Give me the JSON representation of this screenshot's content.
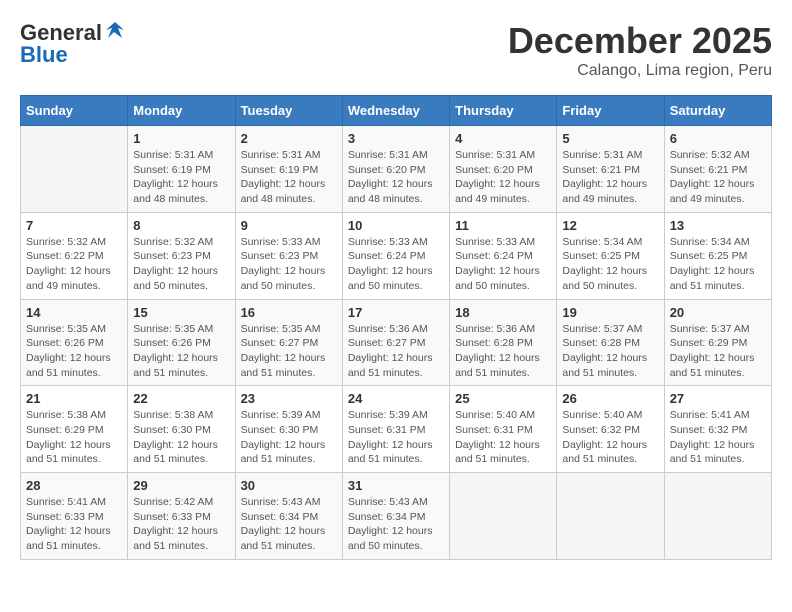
{
  "header": {
    "logo_general": "General",
    "logo_blue": "Blue",
    "title": "December 2025",
    "location": "Calango, Lima region, Peru"
  },
  "weekdays": [
    "Sunday",
    "Monday",
    "Tuesday",
    "Wednesday",
    "Thursday",
    "Friday",
    "Saturday"
  ],
  "weeks": [
    [
      {
        "day": "",
        "info": ""
      },
      {
        "day": "1",
        "info": "Sunrise: 5:31 AM\nSunset: 6:19 PM\nDaylight: 12 hours\nand 48 minutes."
      },
      {
        "day": "2",
        "info": "Sunrise: 5:31 AM\nSunset: 6:19 PM\nDaylight: 12 hours\nand 48 minutes."
      },
      {
        "day": "3",
        "info": "Sunrise: 5:31 AM\nSunset: 6:20 PM\nDaylight: 12 hours\nand 48 minutes."
      },
      {
        "day": "4",
        "info": "Sunrise: 5:31 AM\nSunset: 6:20 PM\nDaylight: 12 hours\nand 49 minutes."
      },
      {
        "day": "5",
        "info": "Sunrise: 5:31 AM\nSunset: 6:21 PM\nDaylight: 12 hours\nand 49 minutes."
      },
      {
        "day": "6",
        "info": "Sunrise: 5:32 AM\nSunset: 6:21 PM\nDaylight: 12 hours\nand 49 minutes."
      }
    ],
    [
      {
        "day": "7",
        "info": "Sunrise: 5:32 AM\nSunset: 6:22 PM\nDaylight: 12 hours\nand 49 minutes."
      },
      {
        "day": "8",
        "info": "Sunrise: 5:32 AM\nSunset: 6:23 PM\nDaylight: 12 hours\nand 50 minutes."
      },
      {
        "day": "9",
        "info": "Sunrise: 5:33 AM\nSunset: 6:23 PM\nDaylight: 12 hours\nand 50 minutes."
      },
      {
        "day": "10",
        "info": "Sunrise: 5:33 AM\nSunset: 6:24 PM\nDaylight: 12 hours\nand 50 minutes."
      },
      {
        "day": "11",
        "info": "Sunrise: 5:33 AM\nSunset: 6:24 PM\nDaylight: 12 hours\nand 50 minutes."
      },
      {
        "day": "12",
        "info": "Sunrise: 5:34 AM\nSunset: 6:25 PM\nDaylight: 12 hours\nand 50 minutes."
      },
      {
        "day": "13",
        "info": "Sunrise: 5:34 AM\nSunset: 6:25 PM\nDaylight: 12 hours\nand 51 minutes."
      }
    ],
    [
      {
        "day": "14",
        "info": "Sunrise: 5:35 AM\nSunset: 6:26 PM\nDaylight: 12 hours\nand 51 minutes."
      },
      {
        "day": "15",
        "info": "Sunrise: 5:35 AM\nSunset: 6:26 PM\nDaylight: 12 hours\nand 51 minutes."
      },
      {
        "day": "16",
        "info": "Sunrise: 5:35 AM\nSunset: 6:27 PM\nDaylight: 12 hours\nand 51 minutes."
      },
      {
        "day": "17",
        "info": "Sunrise: 5:36 AM\nSunset: 6:27 PM\nDaylight: 12 hours\nand 51 minutes."
      },
      {
        "day": "18",
        "info": "Sunrise: 5:36 AM\nSunset: 6:28 PM\nDaylight: 12 hours\nand 51 minutes."
      },
      {
        "day": "19",
        "info": "Sunrise: 5:37 AM\nSunset: 6:28 PM\nDaylight: 12 hours\nand 51 minutes."
      },
      {
        "day": "20",
        "info": "Sunrise: 5:37 AM\nSunset: 6:29 PM\nDaylight: 12 hours\nand 51 minutes."
      }
    ],
    [
      {
        "day": "21",
        "info": "Sunrise: 5:38 AM\nSunset: 6:29 PM\nDaylight: 12 hours\nand 51 minutes."
      },
      {
        "day": "22",
        "info": "Sunrise: 5:38 AM\nSunset: 6:30 PM\nDaylight: 12 hours\nand 51 minutes."
      },
      {
        "day": "23",
        "info": "Sunrise: 5:39 AM\nSunset: 6:30 PM\nDaylight: 12 hours\nand 51 minutes."
      },
      {
        "day": "24",
        "info": "Sunrise: 5:39 AM\nSunset: 6:31 PM\nDaylight: 12 hours\nand 51 minutes."
      },
      {
        "day": "25",
        "info": "Sunrise: 5:40 AM\nSunset: 6:31 PM\nDaylight: 12 hours\nand 51 minutes."
      },
      {
        "day": "26",
        "info": "Sunrise: 5:40 AM\nSunset: 6:32 PM\nDaylight: 12 hours\nand 51 minutes."
      },
      {
        "day": "27",
        "info": "Sunrise: 5:41 AM\nSunset: 6:32 PM\nDaylight: 12 hours\nand 51 minutes."
      }
    ],
    [
      {
        "day": "28",
        "info": "Sunrise: 5:41 AM\nSunset: 6:33 PM\nDaylight: 12 hours\nand 51 minutes."
      },
      {
        "day": "29",
        "info": "Sunrise: 5:42 AM\nSunset: 6:33 PM\nDaylight: 12 hours\nand 51 minutes."
      },
      {
        "day": "30",
        "info": "Sunrise: 5:43 AM\nSunset: 6:34 PM\nDaylight: 12 hours\nand 51 minutes."
      },
      {
        "day": "31",
        "info": "Sunrise: 5:43 AM\nSunset: 6:34 PM\nDaylight: 12 hours\nand 50 minutes."
      },
      {
        "day": "",
        "info": ""
      },
      {
        "day": "",
        "info": ""
      },
      {
        "day": "",
        "info": ""
      }
    ]
  ]
}
